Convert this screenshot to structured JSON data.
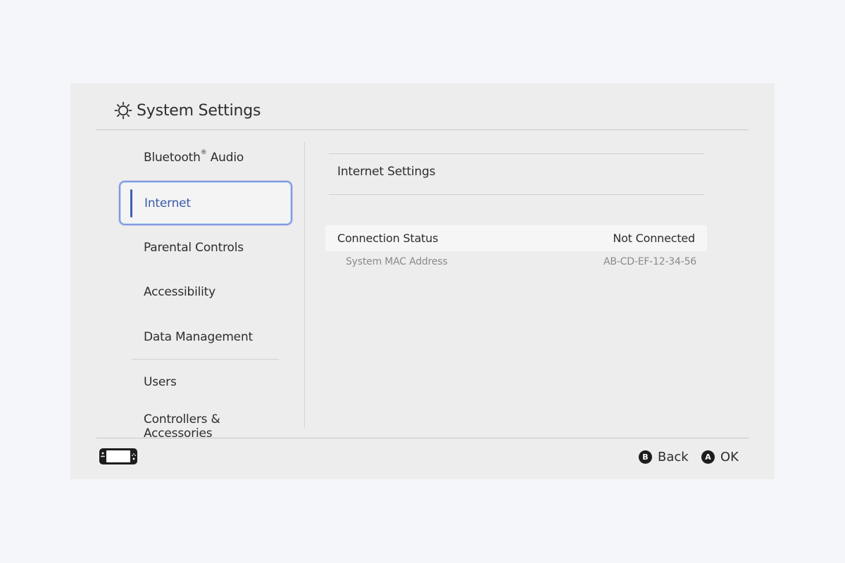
{
  "header": {
    "title": "System Settings",
    "icon": "gear-icon"
  },
  "sidebar": {
    "items": [
      {
        "label": "Bluetooth",
        "trademark": "®",
        "suffix": " Audio"
      },
      {
        "label": "Internet",
        "selected": true
      },
      {
        "label": "Parental Controls"
      },
      {
        "label": "Accessibility"
      },
      {
        "label": "Data Management"
      },
      {
        "label": "Users"
      },
      {
        "label": "Controllers & Accessories"
      }
    ]
  },
  "main": {
    "section_title": "Internet Settings",
    "rows": [
      {
        "label": "Connection Status",
        "value": "Not Connected"
      },
      {
        "label": "System MAC Address",
        "value": "AB-CD-EF-12-34-56"
      }
    ]
  },
  "footer": {
    "console_icon": "console-icon",
    "back": {
      "glyph": "B",
      "label": "Back"
    },
    "ok": {
      "glyph": "A",
      "label": "OK"
    }
  },
  "colors": {
    "page_background": "#f5f6fa",
    "panel_background": "#ededee",
    "selected_text": "#3a5ba8",
    "selected_outline": "#7d9ddb"
  }
}
